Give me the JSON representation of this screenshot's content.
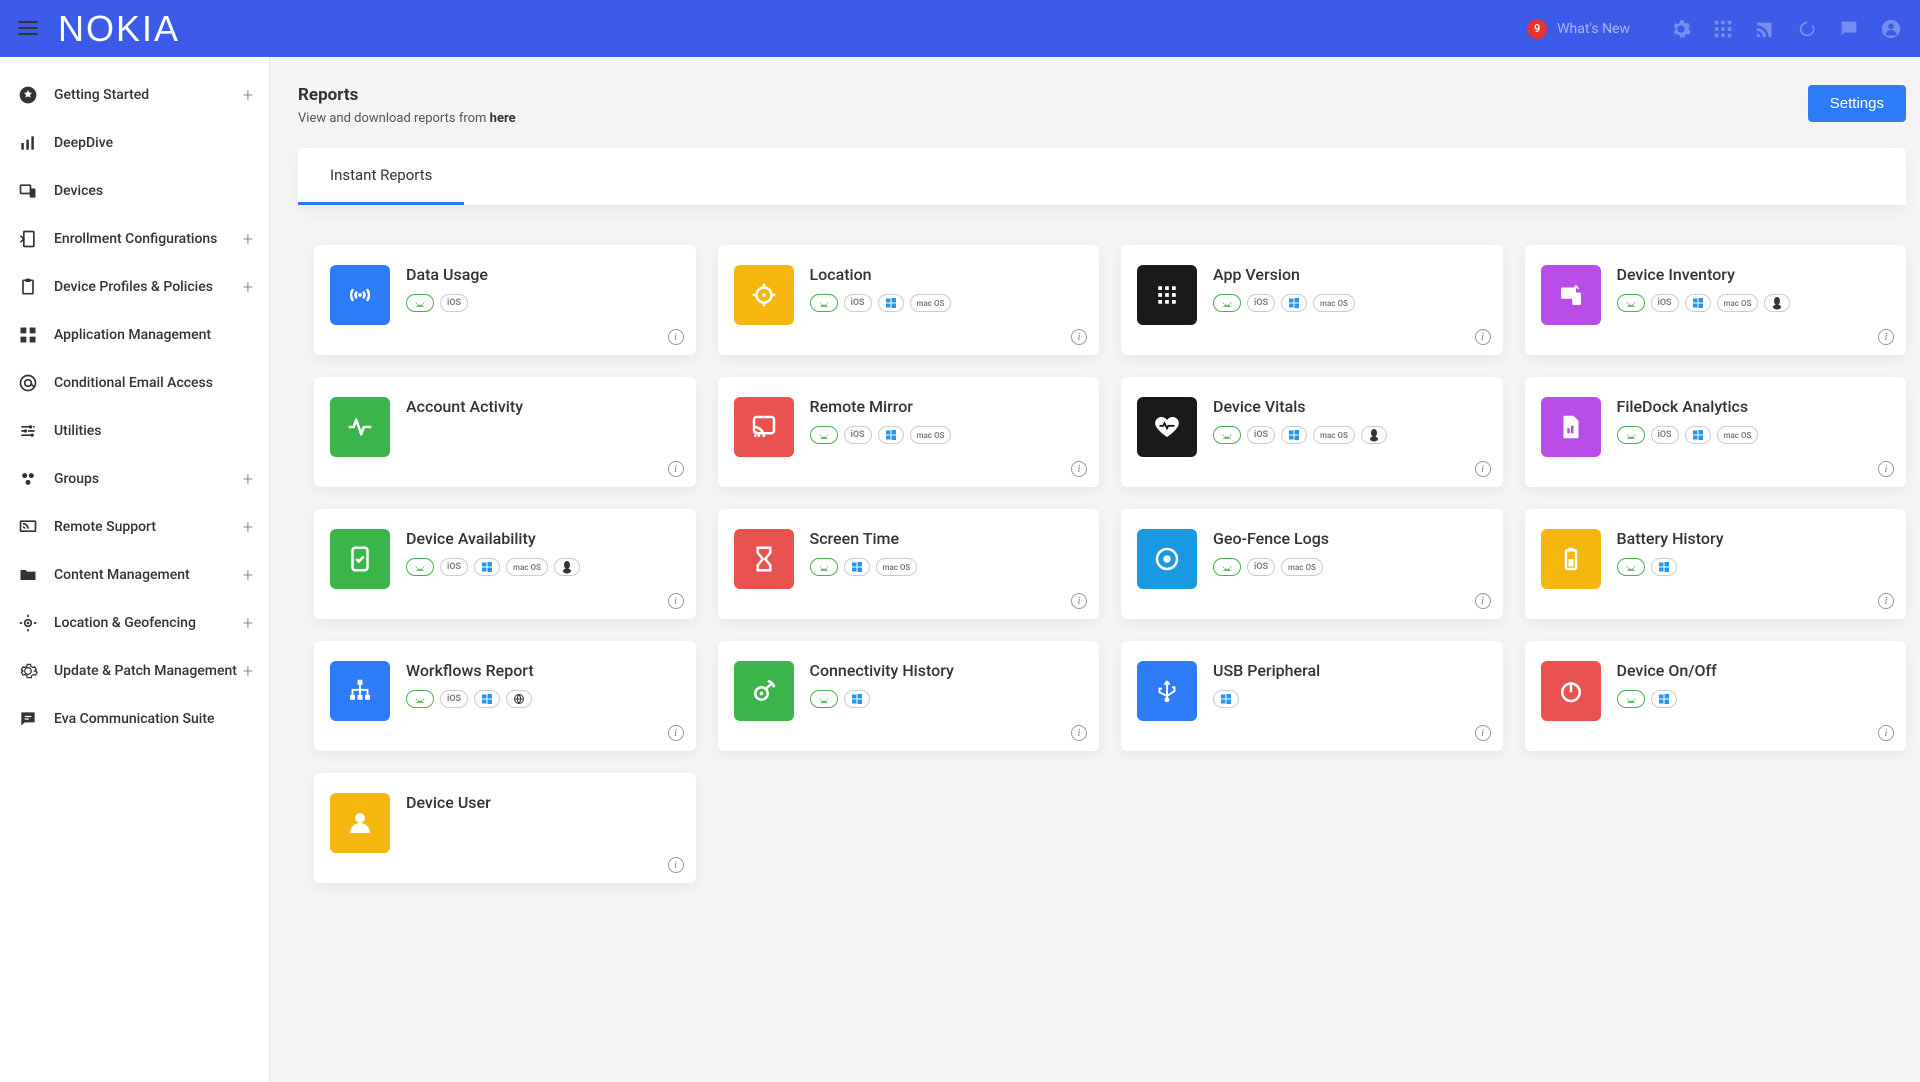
{
  "header": {
    "logo": "NOKIA",
    "whats_new_badge": "9",
    "whats_new_label": "What's New"
  },
  "sidebar": {
    "items": [
      {
        "label": "Getting Started",
        "expandable": true
      },
      {
        "label": "DeepDive",
        "expandable": false
      },
      {
        "label": "Devices",
        "expandable": false
      },
      {
        "label": "Enrollment Configurations",
        "expandable": true
      },
      {
        "label": "Device Profiles & Policies",
        "expandable": true
      },
      {
        "label": "Application Management",
        "expandable": false
      },
      {
        "label": "Conditional Email Access",
        "expandable": false
      },
      {
        "label": "Utilities",
        "expandable": false
      },
      {
        "label": "Groups",
        "expandable": true
      },
      {
        "label": "Remote Support",
        "expandable": true
      },
      {
        "label": "Content Management",
        "expandable": true
      },
      {
        "label": "Location & Geofencing",
        "expandable": true
      },
      {
        "label": "Update & Patch Management",
        "expandable": true
      },
      {
        "label": "Eva Communication Suite",
        "expandable": false
      }
    ]
  },
  "page": {
    "title": "Reports",
    "subtitle_pre": "View and download reports from ",
    "subtitle_link": "here",
    "settings_btn": "Settings",
    "tab_label": "Instant Reports"
  },
  "reports": [
    {
      "title": "Data Usage",
      "color": "bg-blue",
      "icon": "broadcast",
      "platforms": [
        "android",
        "ios"
      ]
    },
    {
      "title": "Location",
      "color": "bg-yellow",
      "icon": "target",
      "platforms": [
        "android",
        "ios",
        "windows",
        "mac"
      ]
    },
    {
      "title": "App Version",
      "color": "bg-black",
      "icon": "grid",
      "platforms": [
        "android",
        "ios",
        "windows",
        "mac"
      ]
    },
    {
      "title": "Device Inventory",
      "color": "bg-purple",
      "icon": "inventory",
      "platforms": [
        "android",
        "ios",
        "windows",
        "mac",
        "linux"
      ]
    },
    {
      "title": "Account Activity",
      "color": "bg-green",
      "icon": "activity",
      "platforms": []
    },
    {
      "title": "Remote Mirror",
      "color": "bg-red",
      "icon": "cast",
      "platforms": [
        "android",
        "ios",
        "windows",
        "mac"
      ]
    },
    {
      "title": "Device Vitals",
      "color": "bg-black",
      "icon": "heart",
      "platforms": [
        "android",
        "ios",
        "windows",
        "mac",
        "linux"
      ]
    },
    {
      "title": "FileDock Analytics",
      "color": "bg-purple",
      "icon": "file",
      "platforms": [
        "android",
        "ios",
        "windows",
        "mac"
      ]
    },
    {
      "title": "Device Availability",
      "color": "bg-green",
      "icon": "check",
      "platforms": [
        "android",
        "ios",
        "windows",
        "mac",
        "linux"
      ]
    },
    {
      "title": "Screen Time",
      "color": "bg-red",
      "icon": "hourglass",
      "platforms": [
        "android",
        "windows",
        "mac"
      ]
    },
    {
      "title": "Geo-Fence Logs",
      "color": "bg-cyan",
      "icon": "pin",
      "platforms": [
        "android",
        "ios",
        "mac"
      ]
    },
    {
      "title": "Battery History",
      "color": "bg-yellow",
      "icon": "battery",
      "platforms": [
        "android",
        "windows"
      ]
    },
    {
      "title": "Workflows Report",
      "color": "bg-blue",
      "icon": "tree",
      "platforms": [
        "android",
        "ios",
        "windows",
        "web"
      ]
    },
    {
      "title": "Connectivity History",
      "color": "bg-green",
      "icon": "satellite",
      "platforms": [
        "android",
        "windows"
      ]
    },
    {
      "title": "USB Peripheral",
      "color": "bg-blue",
      "icon": "usb",
      "platforms": [
        "windows"
      ]
    },
    {
      "title": "Device On/Off",
      "color": "bg-red",
      "icon": "power",
      "platforms": [
        "android",
        "windows"
      ]
    },
    {
      "title": "Device User",
      "color": "bg-yellow",
      "icon": "user",
      "platforms": []
    }
  ]
}
